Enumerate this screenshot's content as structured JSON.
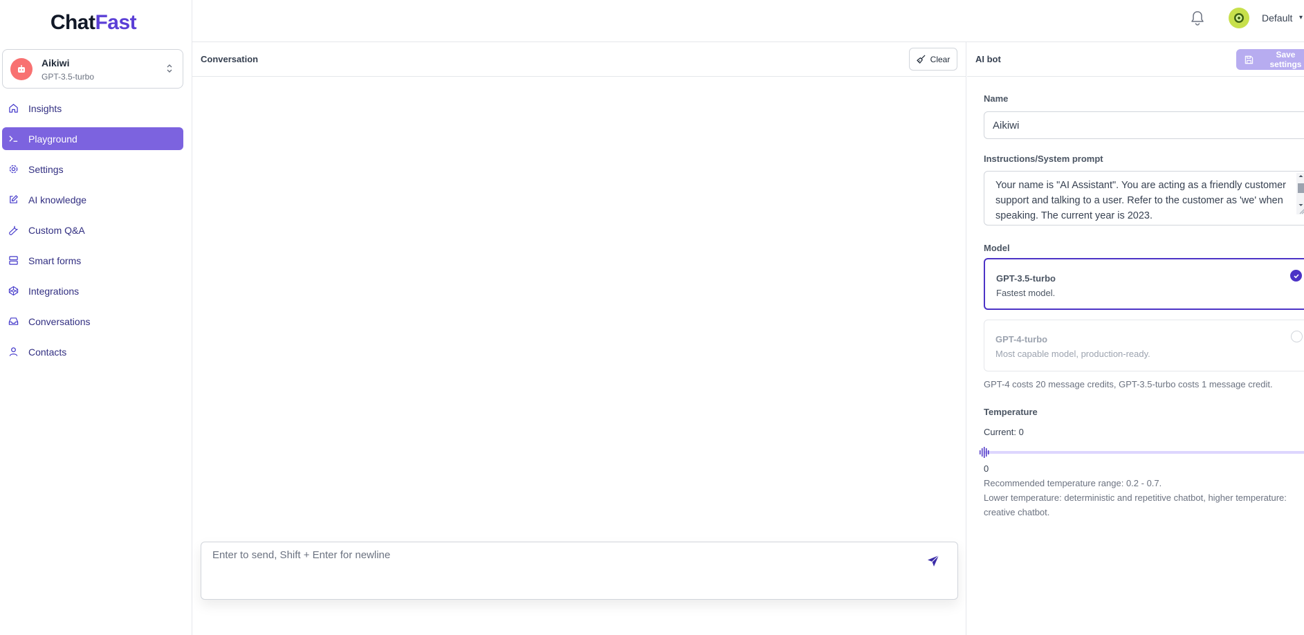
{
  "app": {
    "logo_part1": "Chat",
    "logo_part2": "Fast"
  },
  "bot": {
    "name": "Aikiwi",
    "model": "GPT-3.5-turbo"
  },
  "sidebar": {
    "items": [
      {
        "label": "Insights",
        "icon": "home-icon",
        "active": false
      },
      {
        "label": "Playground",
        "icon": "terminal-icon",
        "active": true
      },
      {
        "label": "Settings",
        "icon": "gear-icon",
        "active": false
      },
      {
        "label": "AI knowledge",
        "icon": "edit-icon",
        "active": false
      },
      {
        "label": "Custom Q&A",
        "icon": "wrench-icon",
        "active": false
      },
      {
        "label": "Smart forms",
        "icon": "server-icon",
        "active": false
      },
      {
        "label": "Integrations",
        "icon": "codepen-icon",
        "active": false
      },
      {
        "label": "Conversations",
        "icon": "inbox-icon",
        "active": false
      },
      {
        "label": "Contacts",
        "icon": "user-icon",
        "active": false
      }
    ]
  },
  "header": {
    "user_name": "Default"
  },
  "conversation": {
    "title": "Conversation",
    "clear_label": "Clear",
    "input_placeholder": "Enter to send, Shift + Enter for newline"
  },
  "settings": {
    "title": "AI bot",
    "save_label": "Save settings",
    "name_label": "Name",
    "name_value": "Aikiwi",
    "prompt_label": "Instructions/System prompt",
    "prompt_value": "Your name is \"AI Assistant\". You are acting as a friendly customer support and talking to a user. Refer to the customer as 'we' when speaking. The current year is 2023.",
    "model_label": "Model",
    "models": [
      {
        "name": "GPT-3.5-turbo",
        "description": "Fastest model.",
        "selected": true
      },
      {
        "name": "GPT-4-turbo",
        "description": "Most capable model, production-ready.",
        "selected": false
      }
    ],
    "model_note": "GPT-4 costs 20 message credits, GPT-3.5-turbo costs 1 message credit.",
    "temperature_label": "Temperature",
    "temperature_current": "Current: 0",
    "temperature_value": 0,
    "temperature_min": "0",
    "temperature_note_1": "Recommended temperature range: 0.2 - 0.7.",
    "temperature_note_2": "Lower temperature: deterministic and repetitive chatbot, higher temperature: creative chatbot."
  },
  "colors": {
    "accent": "#7c63df",
    "accent_dark": "#4c33c6",
    "logo_accent": "#5b3fd6",
    "bot_avatar": "#f87171"
  }
}
